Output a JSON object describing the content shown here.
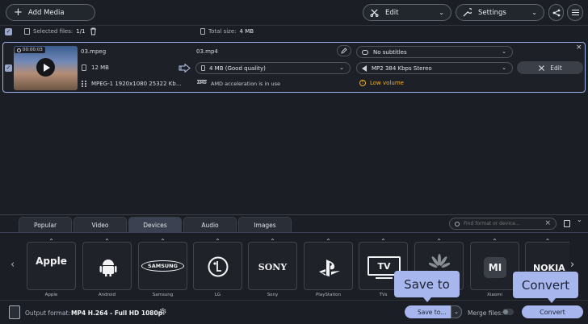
{
  "toolbar": {
    "add_media": "Add Media",
    "edit": "Edit",
    "settings": "Settings"
  },
  "summary": {
    "selected_label": "Selected files:",
    "selected_value": "1/1",
    "total_size_label": "Total size:",
    "total_size_value": "4 MB"
  },
  "file": {
    "duration": "00:00:03",
    "source_name": "03.mpeg",
    "source_size": "12 MB",
    "source_codec": "MPEG-1 1920x1080 25322 Kb...",
    "output_name": "03.mp4",
    "output_quality": "4 MB (Good quality)",
    "acceleration": "AMD acceleration is in use",
    "amd_badge": "AMD",
    "subtitles": "No subtitles",
    "audio": "MP2 384 Kbps Stereo",
    "warning": "Low volume",
    "edit_button": "Edit"
  },
  "tabs": [
    "Popular",
    "Video",
    "Devices",
    "Audio",
    "Images"
  ],
  "search": {
    "placeholder": "Find format or device..."
  },
  "devices": [
    {
      "label": "Apple",
      "logo": "Apple"
    },
    {
      "label": "Android",
      "logo": ""
    },
    {
      "label": "Samsung",
      "logo": "SAMSUNG"
    },
    {
      "label": "LG",
      "logo": ""
    },
    {
      "label": "Sony",
      "logo": "SONY"
    },
    {
      "label": "PlayStation",
      "logo": ""
    },
    {
      "label": "TVs",
      "logo": "TV"
    },
    {
      "label": "",
      "logo": ""
    },
    {
      "label": "Xiaomi",
      "logo": "MI"
    },
    {
      "label": "",
      "logo": "NOKIA"
    }
  ],
  "bottom": {
    "output_format_label": "Output format:",
    "output_format_value": "MP4 H.264 - Full HD 1080p",
    "save_to": "Save to...",
    "merge_files": "Merge files:",
    "convert": "Convert"
  },
  "callouts": {
    "save_to": "Save to",
    "convert": "Convert"
  },
  "colors": {
    "accent": "#a7b7ee",
    "warning": "#f2b01e",
    "background": "#1b1e24"
  }
}
